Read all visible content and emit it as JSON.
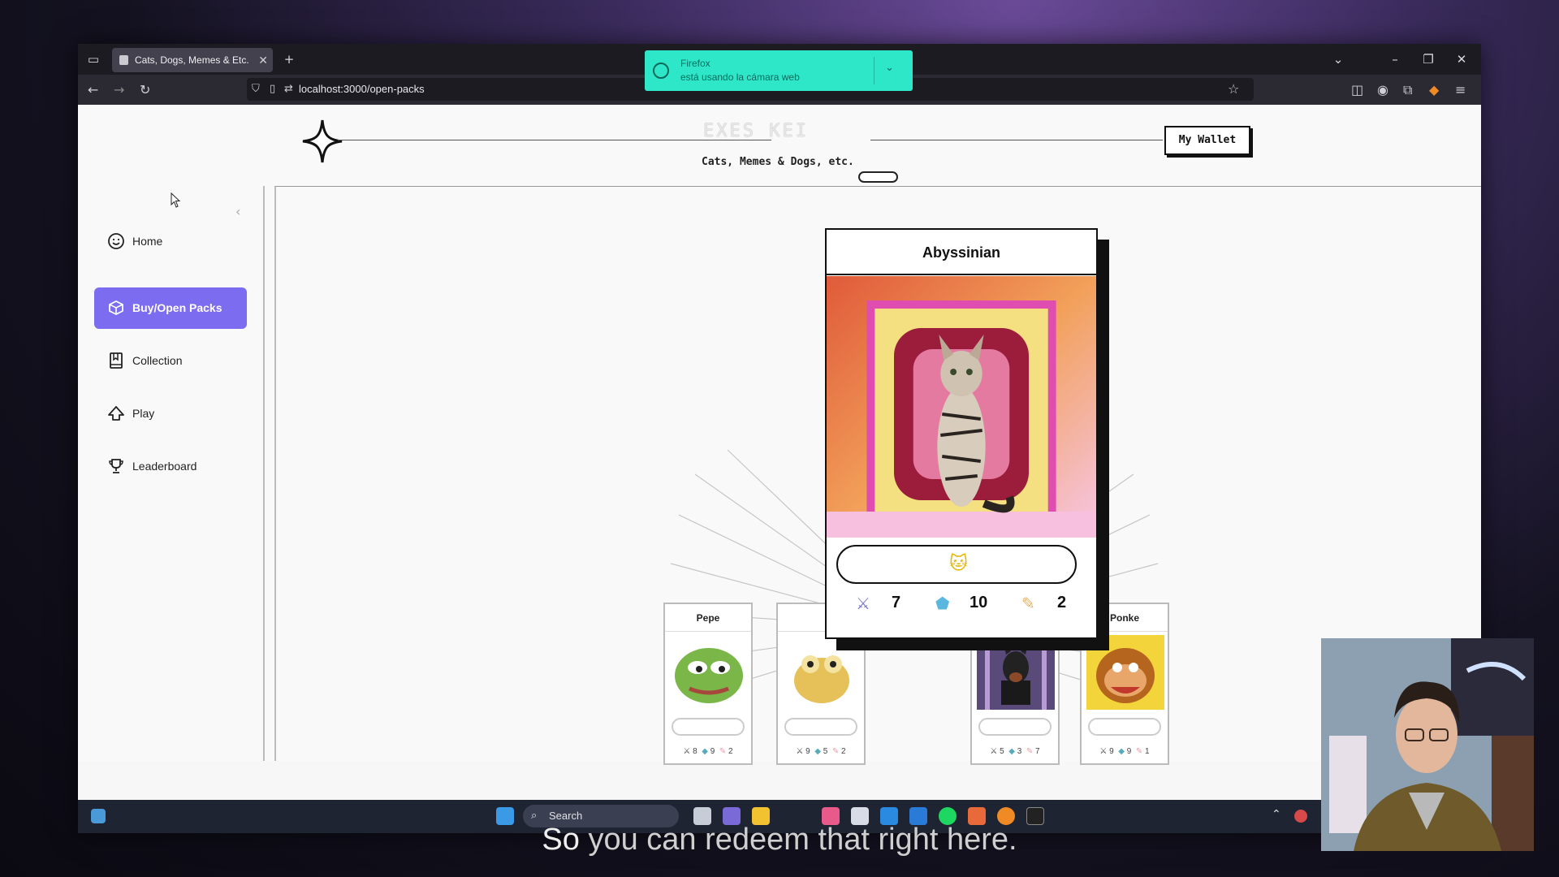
{
  "browser": {
    "tab_title": "Cats, Dogs, Memes & Etc.",
    "url": "localhost:3000/open-packs",
    "notification": {
      "title": "Firefox",
      "message": "está usando la cámara web"
    }
  },
  "header": {
    "logo_text": "Cats, Memes & Dogs, etc.",
    "ghost_text": "EXES  KEI",
    "wallet_label": "My Wallet"
  },
  "sidebar": {
    "items": [
      {
        "label": "Home",
        "icon": "smile-icon",
        "active": false
      },
      {
        "label": "Buy/Open Packs",
        "icon": "box-icon",
        "active": true
      },
      {
        "label": "Collection",
        "icon": "book-icon",
        "active": false
      },
      {
        "label": "Play",
        "icon": "cloud-icon",
        "active": false
      },
      {
        "label": "Leaderboard",
        "icon": "trophy-icon",
        "active": false
      }
    ]
  },
  "featured_card": {
    "name": "Abyssinian",
    "stats": {
      "attack": "7",
      "defense": "10",
      "speed": "2"
    }
  },
  "pack_cards": [
    {
      "name": "Pepe",
      "stats": [
        "8",
        "9",
        "2"
      ]
    },
    {
      "name": "",
      "stats": [
        "9",
        "5",
        "2"
      ]
    },
    {
      "name": "",
      "stats": [
        "5",
        "3",
        "7"
      ]
    },
    {
      "name": "Ponke",
      "stats": [
        "9",
        "9",
        "1"
      ]
    }
  ],
  "taskbar": {
    "search_placeholder": "Search"
  },
  "subtitle": {
    "lead": "So",
    "rest": "you can redeem that right here."
  },
  "colors": {
    "accent": "#7b6cf0",
    "toast": "#2ee6c8"
  }
}
